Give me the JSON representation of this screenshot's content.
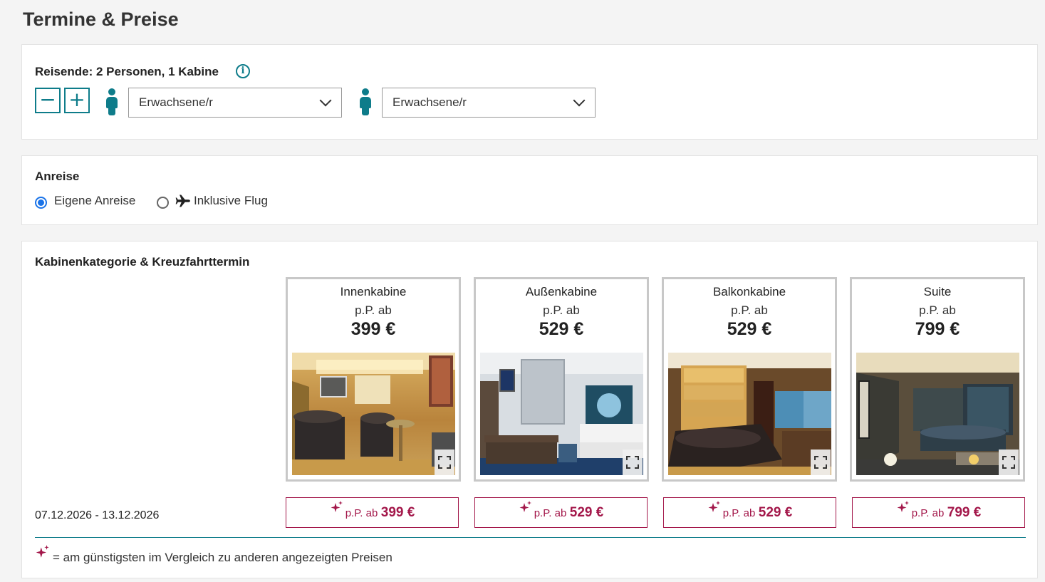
{
  "page": {
    "title": "Termine & Preise"
  },
  "travelers": {
    "heading": "Reisende: 2 Personen, 1 Kabine",
    "minus_label": "−",
    "plus_label": "+",
    "info_label": "i",
    "persons": [
      {
        "type_selected": "Erwachsene/r"
      },
      {
        "type_selected": "Erwachsene/r"
      }
    ]
  },
  "arrival": {
    "heading": "Anreise",
    "options": [
      {
        "label": "Eigene Anreise",
        "selected": true
      },
      {
        "label": "Inklusive Flug",
        "selected": false
      }
    ]
  },
  "cabins": {
    "heading": "Kabinenkategorie & Kreuzfahrttermin",
    "categories": [
      {
        "name": "Innenkabine",
        "per_person": "p.P. ab",
        "price": "399 €"
      },
      {
        "name": "Außenkabine",
        "per_person": "p.P. ab",
        "price": "529 €"
      },
      {
        "name": "Balkonkabine",
        "per_person": "p.P. ab",
        "price": "529 €"
      },
      {
        "name": "Suite",
        "per_person": "p.P. ab",
        "price": "799 €"
      }
    ],
    "date_row": {
      "date": "07.12.2026 - 13.12.2026",
      "prices": [
        {
          "prefix": "p.P. ab",
          "amount": "399 €"
        },
        {
          "prefix": "p.P. ab",
          "amount": "529 €"
        },
        {
          "prefix": "p.P. ab",
          "amount": "529 €"
        },
        {
          "prefix": "p.P. ab",
          "amount": "799 €"
        }
      ]
    },
    "legend": "= am günstigsten im Vergleich zu anderen angezeigten Preisen"
  },
  "colors": {
    "teal": "#0e7c8a",
    "crimson": "#a3174a",
    "radio_blue": "#1a73e8"
  },
  "icons": {
    "info": "info-icon",
    "person": "person-icon",
    "plane": "plane-icon",
    "chevron": "chevron-down-icon",
    "expand": "expand-icon",
    "sparkle": "sparkle-icon"
  }
}
